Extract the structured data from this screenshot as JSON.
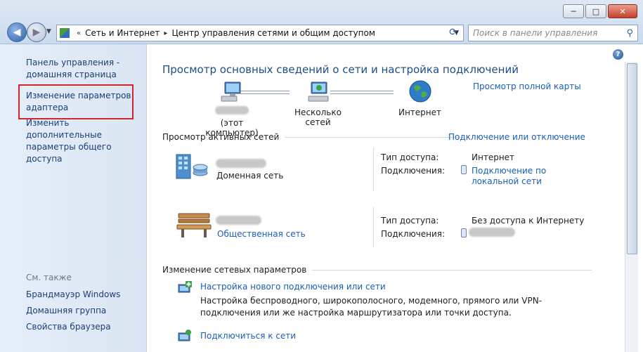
{
  "window": {
    "buttons": {
      "minimize": "─",
      "maximize": "□",
      "close": "✕"
    }
  },
  "address": {
    "crumbs": [
      "Сеть и Интернет",
      "Центр управления сетями и общим доступом"
    ],
    "separator": "▸"
  },
  "search": {
    "placeholder": "Поиск в панели управления"
  },
  "sidebar": {
    "home_line1": "Панель управления -",
    "home_line2": "домашняя страница",
    "adapter_line1": "Изменение параметров",
    "adapter_line2": "адаптера",
    "sharing_line1": "Изменить дополнительные",
    "sharing_line2": "параметры общего доступа",
    "see_also": "См. также",
    "firewall": "Брандмауэр Windows",
    "homegroup": "Домашняя группа",
    "browser": "Свойства браузера"
  },
  "main": {
    "title": "Просмотр основных сведений о сети и настройка подключений",
    "full_map": "Просмотр полной карты",
    "map": {
      "computer": "(этот компьютер)",
      "networks": "Несколько сетей",
      "internet": "Интернет"
    },
    "active_header": "Просмотр активных сетей",
    "connect_disconnect": "Подключение или отключение",
    "networks": [
      {
        "type": "Доменная сеть",
        "access_label": "Тип доступа:",
        "access_value": "Интернет",
        "conn_label": "Подключения:",
        "conn_value_line1": "Подключение по",
        "conn_value_line2": "локальной сети"
      },
      {
        "type": "Общественная сеть",
        "access_label": "Тип доступа:",
        "access_value": "Без доступа к Интернету",
        "conn_label": "Подключения:"
      }
    ],
    "change_header": "Изменение сетевых параметров",
    "actions": [
      {
        "label": "Настройка нового подключения или сети",
        "desc": "Настройка беспроводного, широкополосного, модемного, прямого или VPN-подключения или же настройка маршрутизатора или точки доступа."
      },
      {
        "label": "Подключиться к сети"
      }
    ]
  },
  "help": "?",
  "colors": {
    "highlight_box": "#d0252b",
    "link": "#1a5eb8",
    "title": "#1b4e8d"
  }
}
